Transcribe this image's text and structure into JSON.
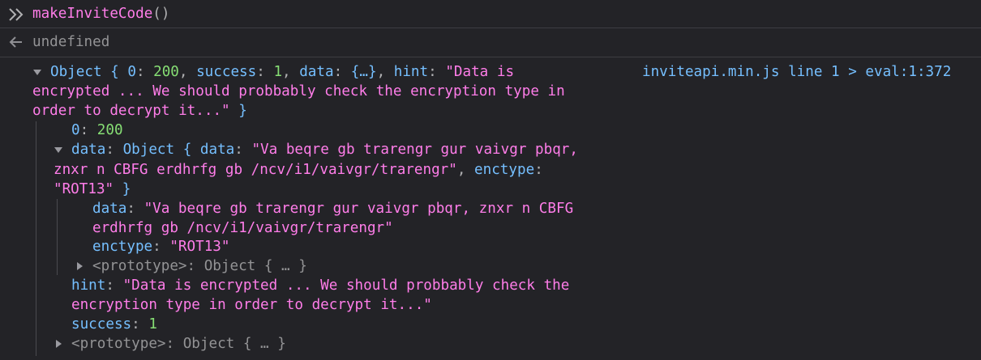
{
  "input": {
    "prompt_icon": "double-chevron-right-icon",
    "command_name": "makeInviteCode",
    "command_args": "()"
  },
  "result": {
    "return_icon": "arrow-left-icon",
    "value": "undefined"
  },
  "log": {
    "source": "inviteapi.min.js line 1 > eval:1:372",
    "summary": {
      "line1_prefix": "Object { ",
      "k0": "0",
      "v0": "200",
      "k_success": "success",
      "v_success": "1",
      "k_data": "data",
      "v_data": "{…}",
      "k_hint": "hint",
      "hint_part1": "\"Data is",
      "hint_part2": "encrypted ... We should probbably check the encryption type in",
      "hint_part3": "order to decrypt it...\"",
      "close": " }"
    },
    "entry0": {
      "key": "0",
      "value": "200"
    },
    "data_node": {
      "key": "data",
      "obj": "Object { ",
      "inner_key": "data",
      "inner_val_part1": "\"Va beqre gb trarengr gur vaivgr pbqr,",
      "inner_val_part2": "znxr n CBFG erdhrfg gb /ncv/i1/vaivgr/trarengr\"",
      "enctype_key": "enctype",
      "enctype_val": "\"ROT13\"",
      "close": " }",
      "child_data_key": "data",
      "child_data_val_part1": "\"Va beqre gb trarengr gur vaivgr pbqr, znxr n CBFG",
      "child_data_val_part2": "erdhrfg gb /ncv/i1/vaivgr/trarengr\"",
      "child_enctype_key": "enctype",
      "child_enctype_val": "\"ROT13\"",
      "proto_label": "<prototype>: Object { … }"
    },
    "hint_node": {
      "key": "hint",
      "val_part1": "\"Data is encrypted ... We should probbably check the",
      "val_part2": "encryption type in order to decrypt it...\""
    },
    "success_node": {
      "key": "success",
      "value": "1"
    },
    "proto_label": "<prototype>: Object { … }"
  }
}
